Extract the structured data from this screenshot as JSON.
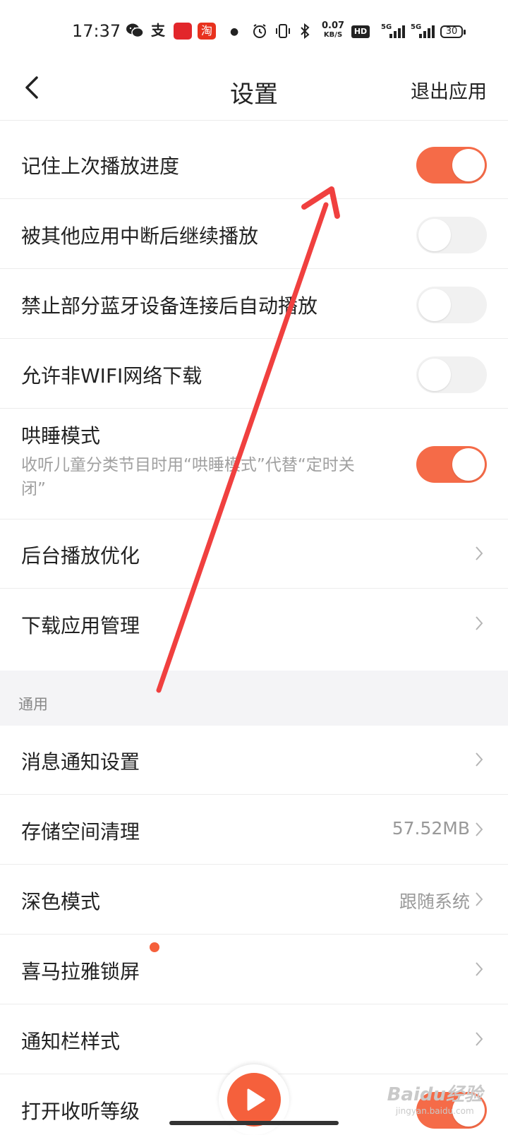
{
  "status_bar": {
    "time": "17:37",
    "net_speed_value": "0.07",
    "net_speed_unit": "KB/S",
    "hd_label": "HD",
    "signal1_label": "5G",
    "signal2_label": "5G",
    "battery": "30",
    "taobao_char": "淘",
    "alipay_char": "支"
  },
  "header": {
    "title": "设置",
    "exit_label": "退出应用"
  },
  "rows": [
    {
      "label": "记住上次播放进度",
      "toggle": true
    },
    {
      "label": "被其他应用中断后继续播放",
      "toggle": false
    },
    {
      "label": "禁止部分蓝牙设备连接后自动播放",
      "toggle": false
    },
    {
      "label": "允许非WIFI网络下载",
      "toggle": false
    },
    {
      "label": "哄睡模式",
      "description": "收听儿童分类节目时用“哄睡模式”代替“定时关闭”",
      "toggle": true
    },
    {
      "label": "后台播放优化"
    },
    {
      "label": "下载应用管理"
    }
  ],
  "section_general": {
    "title": "通用",
    "rows": [
      {
        "label": "消息通知设置"
      },
      {
        "label": "存储空间清理",
        "value": "57.52MB"
      },
      {
        "label": "深色模式",
        "value": "跟随系统"
      },
      {
        "label": "喜马拉雅锁屏"
      },
      {
        "label": "通知栏样式"
      },
      {
        "label": "打开收听等级",
        "toggle": true
      }
    ]
  },
  "watermark": {
    "brand": "Baidu经验",
    "url": "jingyan.baidu.com"
  },
  "colors": {
    "accent": "#f56b48",
    "toggle_off": "#f1f1f1",
    "annotation_arrow": "#f0403f"
  }
}
